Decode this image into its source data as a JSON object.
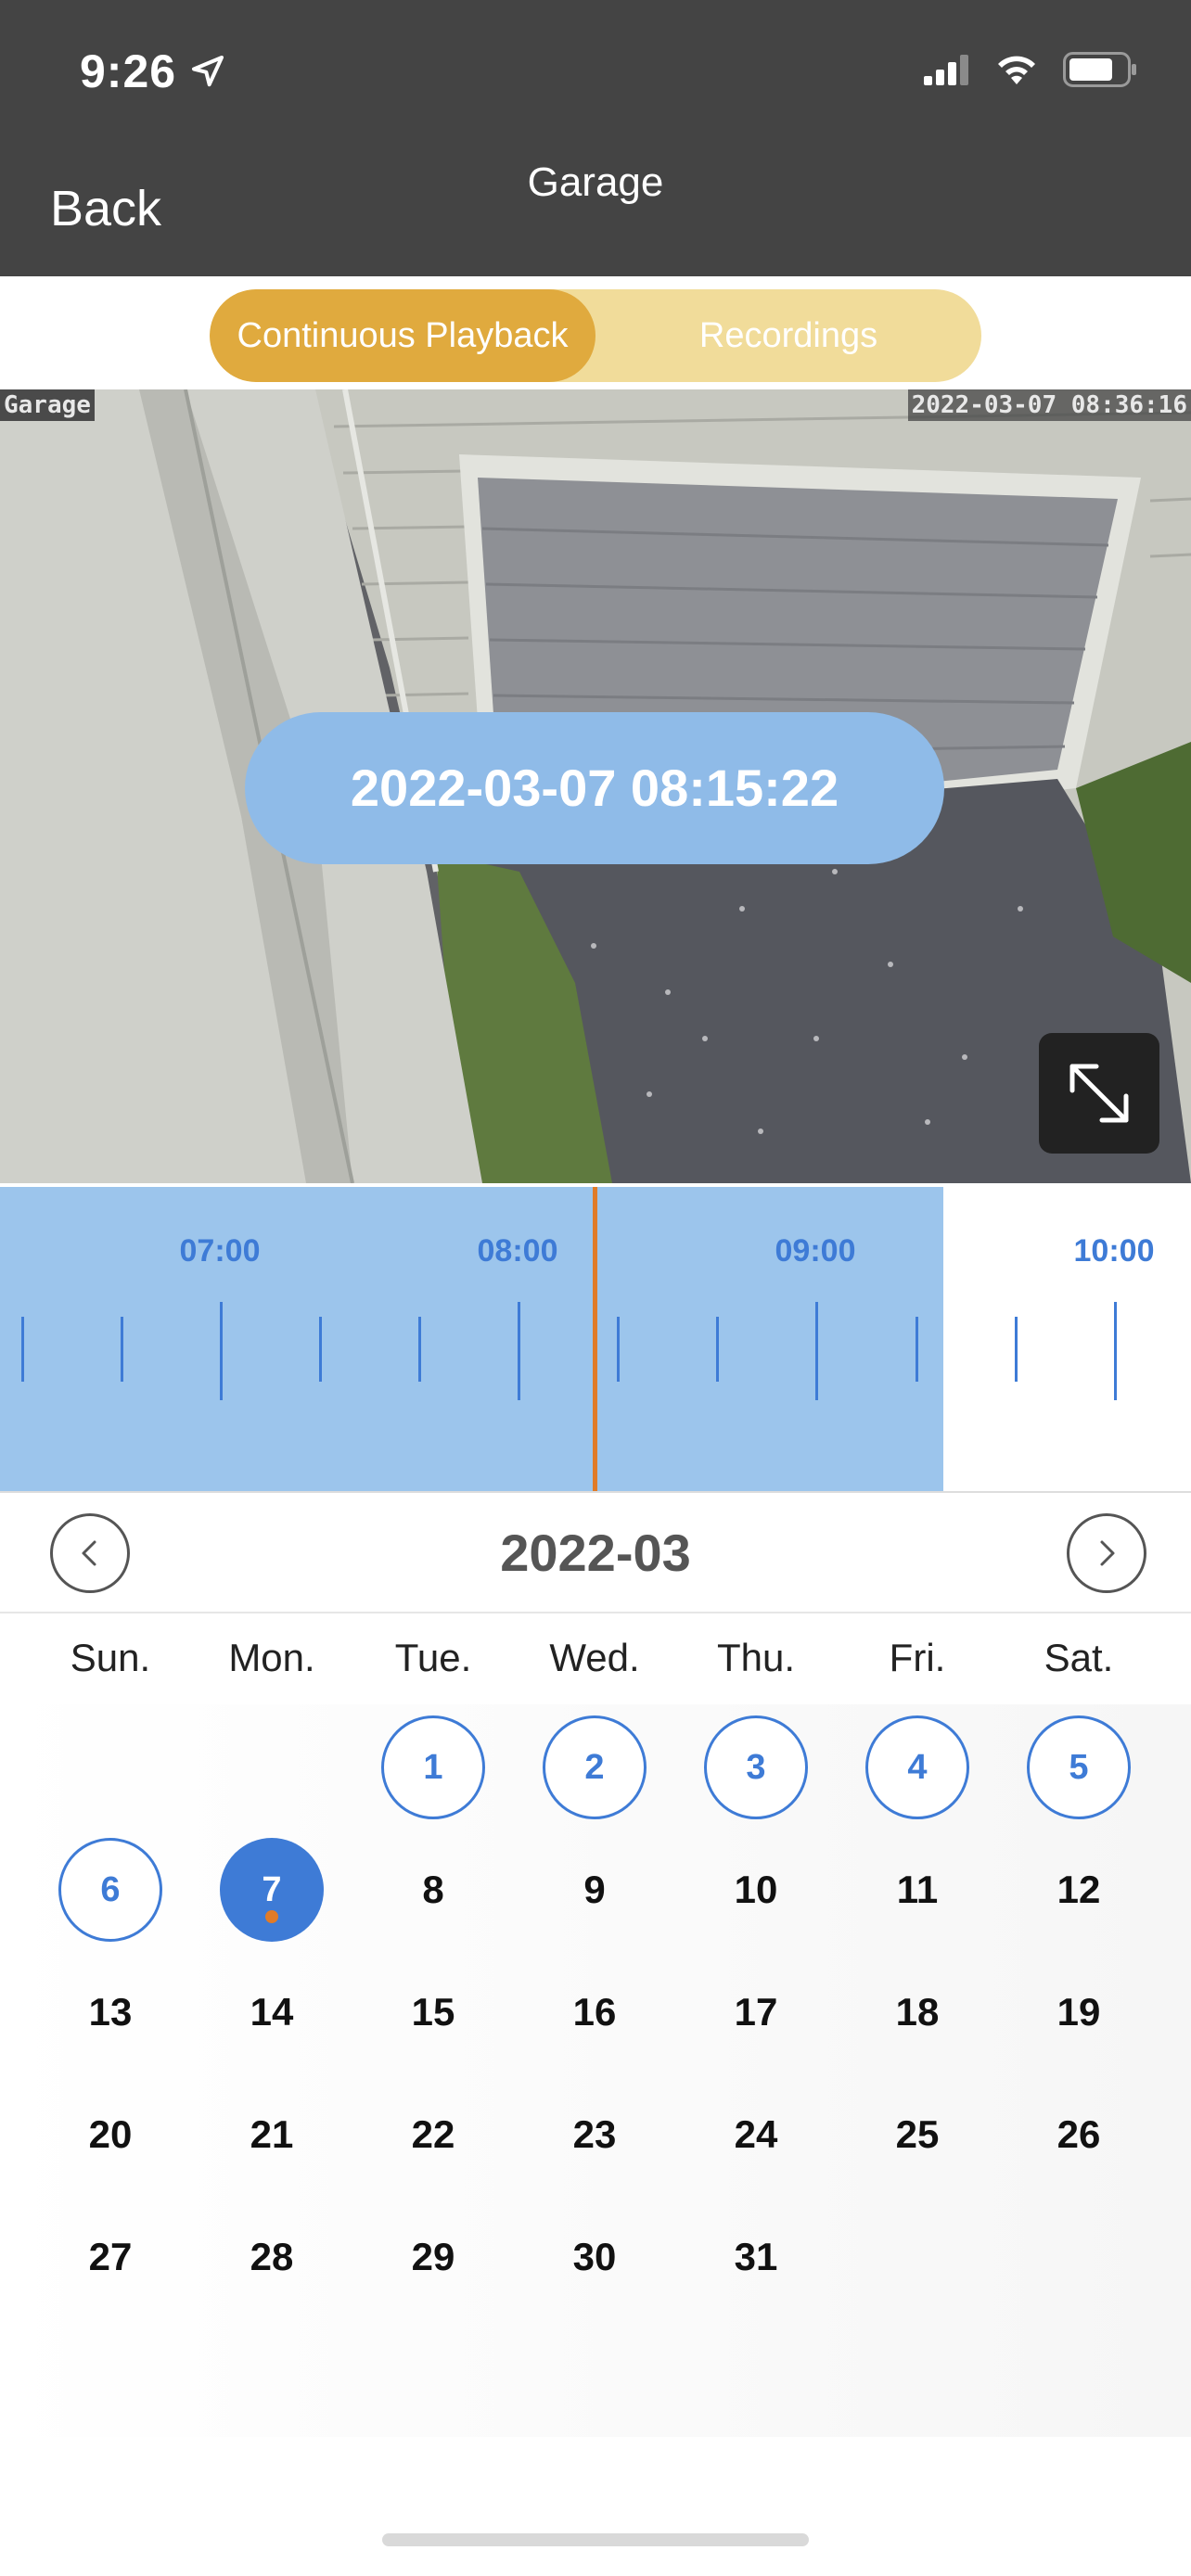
{
  "status_bar": {
    "time": "9:26"
  },
  "nav": {
    "back_label": "Back",
    "title": "Garage"
  },
  "segments": {
    "continuous": "Continuous Playback",
    "recordings": "Recordings",
    "selected": "continuous"
  },
  "video": {
    "camera_label": "Garage",
    "overlay_timestamp": "2022-03-07 08:36:16",
    "current_time": "2022-03-07 08:15:22"
  },
  "timeline": {
    "labels": [
      "07:00",
      "08:00",
      "09:00",
      "10:00"
    ],
    "playhead_time": "08:15",
    "recorded_until": "09:15"
  },
  "calendar": {
    "month": "2022-03",
    "weekdays": [
      "Sun.",
      "Mon.",
      "Tue.",
      "Wed.",
      "Thu.",
      "Fri.",
      "Sat."
    ],
    "first_weekday_index": 2,
    "days_in_month": 31,
    "days_with_recordings": [
      1,
      2,
      3,
      4,
      5,
      6,
      7
    ],
    "selected_day": 7,
    "days": [
      "1",
      "2",
      "3",
      "4",
      "5",
      "6",
      "7",
      "8",
      "9",
      "10",
      "11",
      "12",
      "13",
      "14",
      "15",
      "16",
      "17",
      "18",
      "19",
      "20",
      "21",
      "22",
      "23",
      "24",
      "25",
      "26",
      "27",
      "28",
      "29",
      "30",
      "31"
    ]
  },
  "colors": {
    "header_bg": "#444444",
    "segment_active": "#e0aa3e",
    "segment_inactive": "#f1dc9a",
    "accent_blue": "#3e7bd6",
    "timeline_fill": "#9cc5ec",
    "playhead": "#e07b28"
  },
  "icons": {
    "location": "location-arrow-icon",
    "signal": "cellular-signal-icon",
    "wifi": "wifi-icon",
    "battery": "battery-icon",
    "fullscreen": "expand-icon",
    "prev": "chevron-left-icon",
    "next": "chevron-right-icon"
  }
}
